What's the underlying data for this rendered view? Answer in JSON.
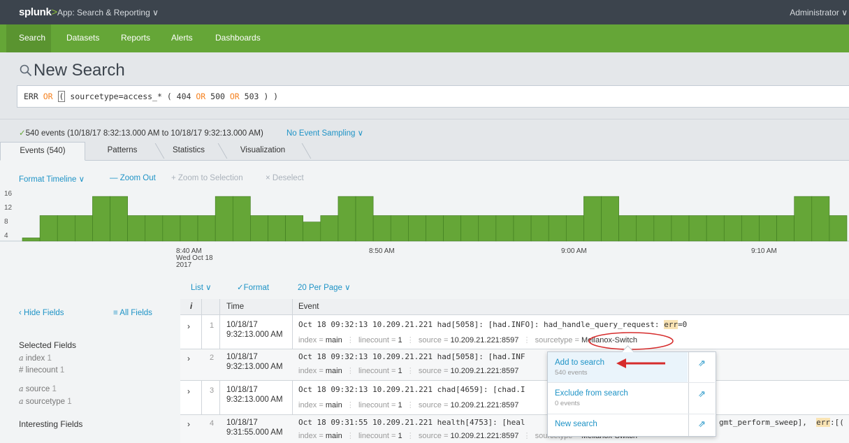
{
  "topbar": {
    "logo": "splunk",
    "logo_suffix": ">",
    "app": "App: Search & Reporting ∨",
    "user": "Administrator ∨"
  },
  "nav": {
    "items": [
      "Search",
      "Datasets",
      "Reports",
      "Alerts",
      "Dashboards"
    ]
  },
  "search": {
    "title": "New Search",
    "query": {
      "p1": "ERR ",
      "op1": "OR",
      "p2": " ",
      "cursor": "(",
      "p3": " sourcetype=access_* ( 404 ",
      "op2": "OR",
      "p4": " 500 ",
      "op3": "OR",
      "p5": " 503 ) )"
    }
  },
  "status": {
    "check": "✓",
    "text": "540 events (10/18/17 8:32:13.000 AM to 10/18/17 9:32:13.000 AM)",
    "sampling": "No Event Sampling ∨"
  },
  "tabs": [
    "Events (540)",
    "Patterns",
    "Statistics",
    "Visualization"
  ],
  "timeline_controls": {
    "format": "Format Timeline ∨",
    "zoom_out": "— Zoom Out",
    "zoom_sel": "+ Zoom to Selection",
    "deselect": "× Deselect"
  },
  "chart_data": {
    "type": "bar",
    "y_ticks": [
      "16",
      "12",
      "8",
      "4"
    ],
    "ylim": [
      0,
      16
    ],
    "values": [
      1,
      8,
      8,
      8,
      14,
      14,
      8,
      8,
      8,
      8,
      8,
      14,
      14,
      8,
      8,
      8,
      6,
      8,
      14,
      14,
      8,
      8,
      8,
      8,
      8,
      8,
      8,
      8,
      8,
      8,
      8,
      8,
      14,
      14,
      8,
      8,
      8,
      8,
      8,
      8,
      8,
      8,
      8,
      8,
      14,
      14,
      8
    ],
    "x_labels": [
      {
        "line1": "8:40 AM",
        "line2": "Wed Oct 18",
        "line3": "2017"
      },
      {
        "line1": "8:50 AM"
      },
      {
        "line1": "9:00 AM"
      },
      {
        "line1": "9:10 AM"
      }
    ],
    "bar_color": "#65a637"
  },
  "list_controls": {
    "list": "List ∨",
    "format": "✓Format",
    "per_page": "20 Per Page ∨"
  },
  "fields": {
    "hide": "‹ Hide Fields",
    "all": "≡ All Fields",
    "selected_heading": "Selected Fields",
    "selected": [
      {
        "type": "a",
        "name": "index",
        "count": "1"
      },
      {
        "type": "#",
        "name": "linecount",
        "count": "1"
      },
      {
        "type": "a",
        "name": "source",
        "count": "1"
      },
      {
        "type": "a",
        "name": "sourcetype",
        "count": "1"
      }
    ],
    "interesting_heading": "Interesting Fields"
  },
  "table": {
    "headers": {
      "info": "i",
      "time": "Time",
      "event": "Event"
    },
    "rows": [
      {
        "num": "1",
        "date": "10/18/17",
        "time": "9:32:13.000 AM",
        "raw_a": "Oct 18 09:32:13 10.209.21.221 had[5058]: [had.INFO]: had_handle_query_request: ",
        "raw_hl": "err",
        "raw_b": "=0"
      },
      {
        "num": "2",
        "date": "10/18/17",
        "time": "9:32:13.000 AM",
        "raw_a": "Oct 18 09:32:13 10.209.21.221 had[5058]: [had.INF",
        "raw_hl": "",
        "raw_b": ""
      },
      {
        "num": "3",
        "date": "10/18/17",
        "time": "9:32:13.000 AM",
        "raw_a": "Oct 18 09:32:13 10.209.21.221 chad[4659]: [chad.I",
        "raw_hl": "",
        "raw_b": ""
      },
      {
        "num": "4",
        "date": "10/18/17",
        "time": "9:31:55.000 AM",
        "raw_a": "Oct 18 09:31:55 10.209.21.221 health[4753]: [heal",
        "raw_tail_a": "gmt_perform_sweep],  ",
        "raw_hl": "err",
        "raw_tail_b": ":[("
      }
    ],
    "meta": {
      "index_k": "index = ",
      "index_v": "main",
      "lc_k": "linecount = ",
      "lc_v": "1",
      "src_k": "source = ",
      "src_v": "10.209.21.221:8597",
      "st_k": "sourcetype",
      "st_eq": " = ",
      "st_v": "Mellanox-Switch"
    }
  },
  "popup": {
    "items": [
      {
        "label": "Add to search",
        "sub": "540 events"
      },
      {
        "label": "Exclude from search",
        "sub": "0 events"
      },
      {
        "label": "New search",
        "sub": ""
      }
    ],
    "ext_icon": "⇗"
  }
}
